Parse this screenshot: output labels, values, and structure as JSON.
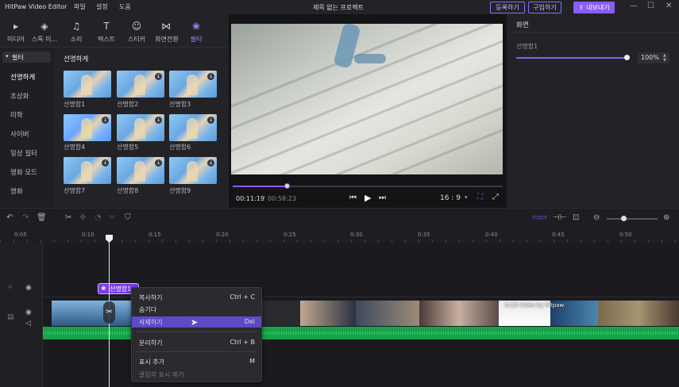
{
  "app": {
    "title": "HitPaw Video Editor",
    "project": "제목 없는 프로젝트"
  },
  "menu": [
    "파일",
    "설정",
    "도움"
  ],
  "header_buttons": {
    "register": "등록하기",
    "buy": "구입하기",
    "export": "내보내기"
  },
  "tabs": [
    {
      "label": "미디어",
      "icon": "▸"
    },
    {
      "label": "스톡 미...",
      "icon": "◈"
    },
    {
      "label": "소리",
      "icon": "♫"
    },
    {
      "label": "텍스트",
      "icon": "T"
    },
    {
      "label": "스티커",
      "icon": "☺"
    },
    {
      "label": "화면전환",
      "icon": "⋈"
    },
    {
      "label": "필터",
      "icon": "❀"
    }
  ],
  "sidebar": {
    "section": "필터",
    "items": [
      "선명하게",
      "초상화",
      "미학",
      "사이버",
      "일상 필터",
      "영화 모드",
      "영화"
    ]
  },
  "filters": {
    "section_title": "선명하게",
    "items": [
      "선명함1",
      "선명함2",
      "선명함3",
      "선명함4",
      "선명함5",
      "선명함6",
      "선명함7",
      "선명함8",
      "선명함9"
    ]
  },
  "player": {
    "current_time": "00:11:19",
    "total_time": "00:58:23",
    "progress": 0.2,
    "aspect": "16 : 9"
  },
  "screen_panel": {
    "title": "화면",
    "slider_label": "선명함1",
    "value": "100%",
    "level": 1.0
  },
  "ruler": [
    "0:05",
    "0:10",
    "0:15",
    "0:20",
    "0:25",
    "0:30",
    "0:35",
    "0:40",
    "0:45",
    "0:50"
  ],
  "filter_clip_label": "선명함1",
  "video_clip_label": "0:18   Video by hitpaw",
  "context_menu": [
    {
      "label": "복사하기",
      "key": "Ctrl + C"
    },
    {
      "label": "숨기다",
      "key": ""
    },
    {
      "label": "삭제하기",
      "key": "Del"
    },
    {
      "label": "분리하기",
      "key": "Ctrl + B"
    },
    {
      "label": "표시 추가",
      "key": "M"
    },
    {
      "label": "클립의 표시 제거",
      "key": ""
    }
  ],
  "colors": {
    "accent": "#8b5cf6",
    "audio": "#16a34a",
    "highlight": "#5b4bc4"
  }
}
